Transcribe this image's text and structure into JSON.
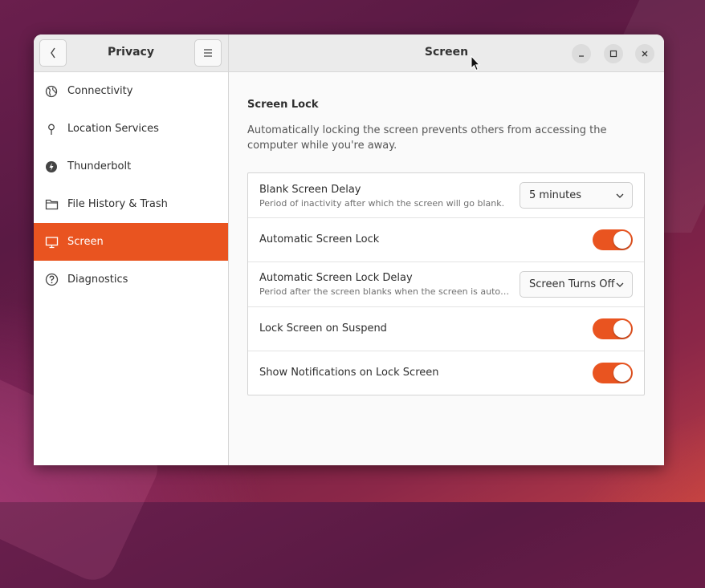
{
  "sidebar": {
    "title": "Privacy",
    "items": [
      {
        "label": "Connectivity",
        "icon": "globe-icon"
      },
      {
        "label": "Location Services",
        "icon": "location-pin-icon"
      },
      {
        "label": "Thunderbolt",
        "icon": "thunderbolt-icon"
      },
      {
        "label": "File History & Trash",
        "icon": "folder-icon"
      },
      {
        "label": "Screen",
        "icon": "monitor-icon",
        "active": true
      },
      {
        "label": "Diagnostics",
        "icon": "help-icon"
      }
    ]
  },
  "header": {
    "title": "Screen"
  },
  "content": {
    "section_title": "Screen Lock",
    "section_desc": "Automatically locking the screen prevents others from accessing the computer while you're away.",
    "rows": {
      "blank_delay": {
        "label": "Blank Screen Delay",
        "sub": "Period of inactivity after which the screen will go blank.",
        "value": "5 minutes"
      },
      "auto_lock": {
        "label": "Automatic Screen Lock",
        "on": true
      },
      "auto_lock_delay": {
        "label": "Automatic Screen Lock Delay",
        "sub": "Period after the screen blanks when the screen is automatically locked.",
        "value": "Screen Turns Off"
      },
      "lock_on_suspend": {
        "label": "Lock Screen on Suspend",
        "on": true
      },
      "notifications": {
        "label": "Show Notifications on Lock Screen",
        "on": true
      }
    }
  },
  "colors": {
    "accent": "#e95420"
  }
}
